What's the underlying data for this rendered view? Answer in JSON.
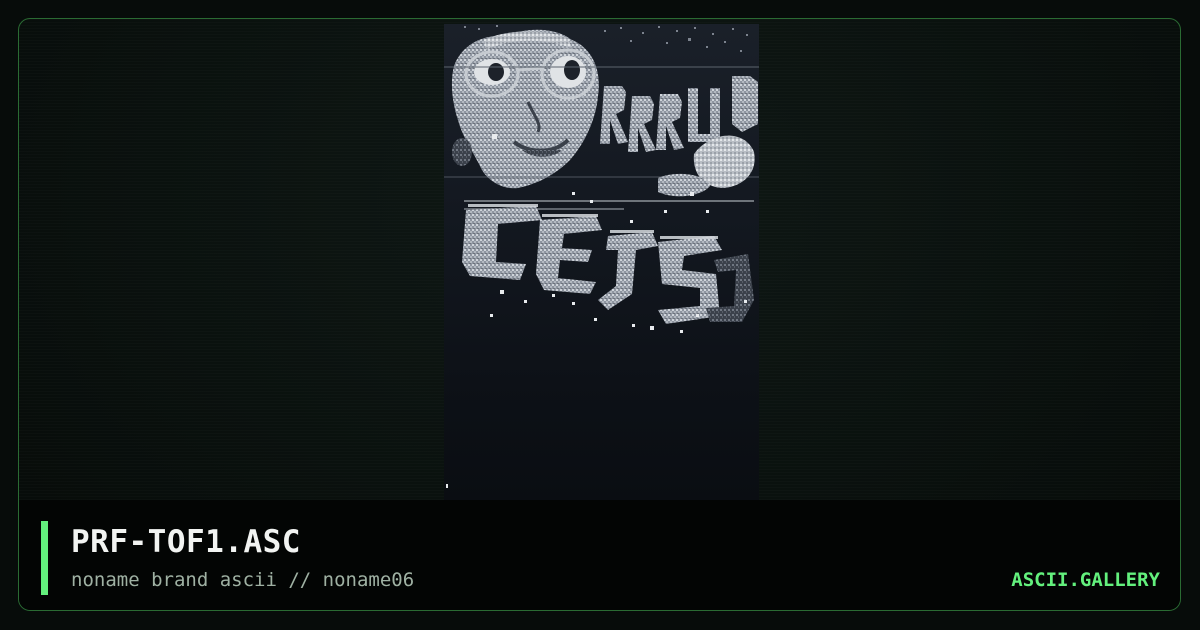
{
  "artwork": {
    "alt": "PRF-TOF1.ASC ascii artwork"
  },
  "caption": {
    "title": "PRF-TOF1.ASC",
    "subtitle": "noname brand ascii // noname06",
    "brand": "ASCII.GALLERY"
  },
  "colors": {
    "accent": "#63f07d",
    "border": "#2a6b33",
    "background": "#070c0a",
    "title": "#f2f4f2",
    "subtitle": "#9fb1a3"
  }
}
